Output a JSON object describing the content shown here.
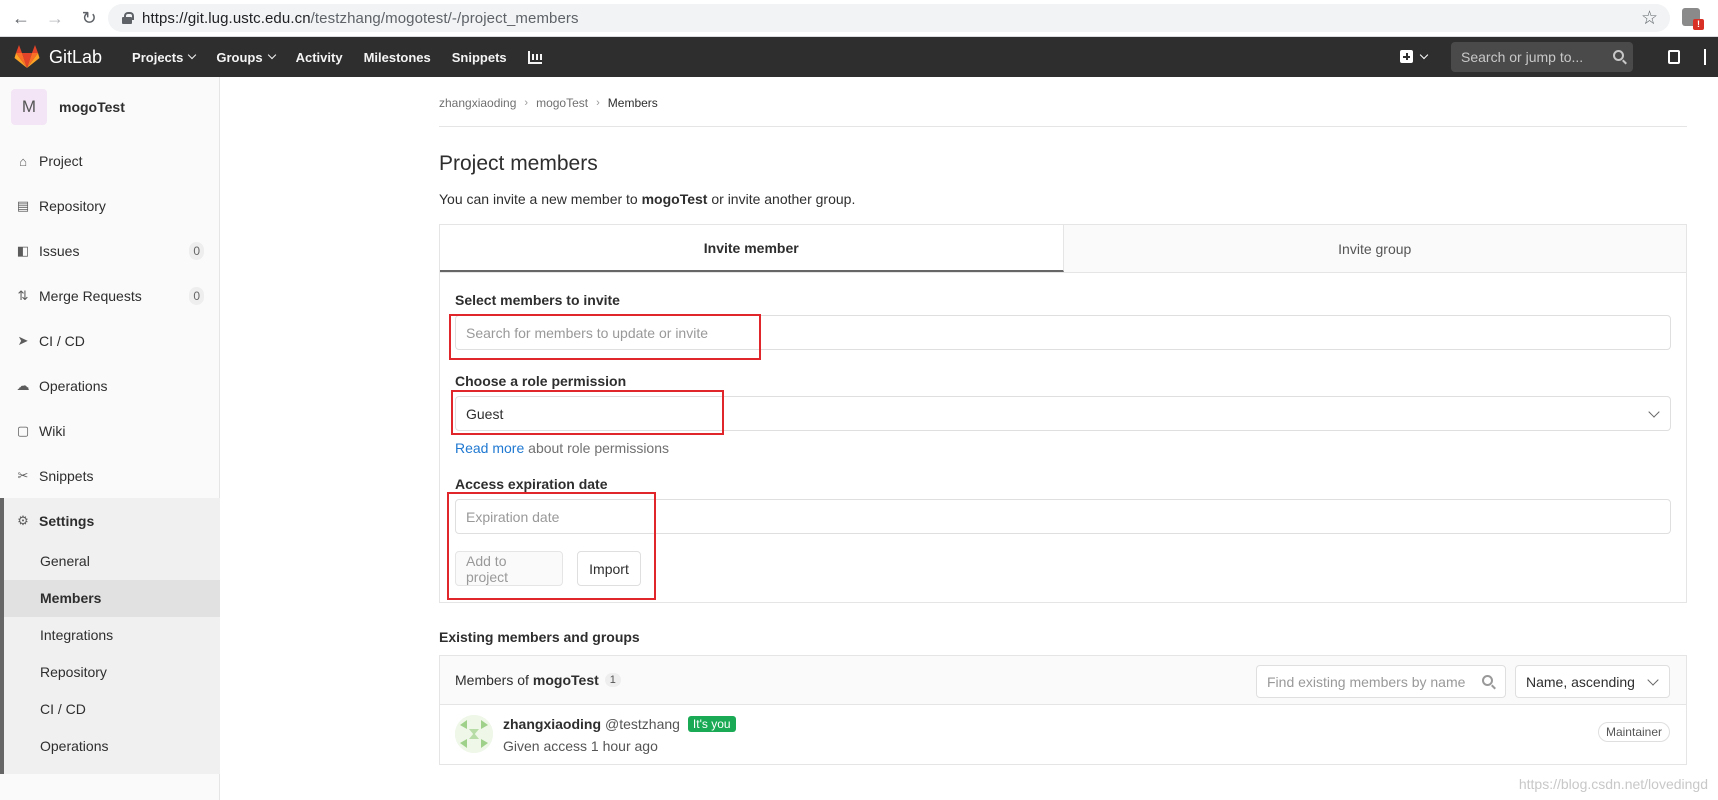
{
  "browser": {
    "url_host": "https://git.lug.ustc.edu.cn",
    "url_path": "/testzhang/mogotest/-/project_members"
  },
  "header": {
    "brand": "GitLab",
    "nav": [
      {
        "label": "Projects",
        "dropdown": true
      },
      {
        "label": "Groups",
        "dropdown": true
      },
      {
        "label": "Activity",
        "dropdown": false
      },
      {
        "label": "Milestones",
        "dropdown": false
      },
      {
        "label": "Snippets",
        "dropdown": false
      }
    ],
    "search_placeholder": "Search or jump to..."
  },
  "sidebar": {
    "avatar_letter": "M",
    "project_name": "mogoTest",
    "items": [
      {
        "label": "Project",
        "icon": "home-icon"
      },
      {
        "label": "Repository",
        "icon": "doc-icon"
      },
      {
        "label": "Issues",
        "icon": "issues-icon",
        "count": "0"
      },
      {
        "label": "Merge Requests",
        "icon": "merge-icon",
        "count": "0"
      },
      {
        "label": "CI / CD",
        "icon": "rocket-icon"
      },
      {
        "label": "Operations",
        "icon": "cloud-gear-icon"
      },
      {
        "label": "Wiki",
        "icon": "book-icon"
      },
      {
        "label": "Snippets",
        "icon": "scissors-icon"
      },
      {
        "label": "Settings",
        "icon": "gear-icon"
      }
    ],
    "settings_sub": [
      "General",
      "Members",
      "Integrations",
      "Repository",
      "CI / CD",
      "Operations"
    ]
  },
  "breadcrumb": [
    "zhangxiaoding",
    "mogoTest",
    "Members"
  ],
  "page": {
    "title": "Project members",
    "desc_prefix": "You can invite a new member to ",
    "desc_project": "mogoTest",
    "desc_suffix": " or invite another group."
  },
  "invite": {
    "tabs": [
      "Invite member",
      "Invite group"
    ],
    "select_label": "Select members to invite",
    "select_placeholder": "Search for members to update or invite",
    "role_label": "Choose a role permission",
    "role_value": "Guest",
    "read_more": "Read more",
    "read_more_suffix": " about role permissions",
    "expiry_label": "Access expiration date",
    "expiry_placeholder": "Expiration date",
    "add_button": "Add to project",
    "import_button": "Import"
  },
  "existing": {
    "title": "Existing members and groups",
    "members_of": "Members of",
    "project": "mogoTest",
    "count": "1",
    "find_placeholder": "Find existing members by name",
    "sort_value": "Name, ascending",
    "members": [
      {
        "name": "zhangxiaoding",
        "username": "@testzhang",
        "badge": "It's you",
        "access": "Given access 1 hour ago",
        "role": "Maintainer"
      }
    ]
  },
  "watermark": "https://blog.csdn.net/lovedingd",
  "colors": {
    "accent_blue": "#1f78d1",
    "badge_green": "#1aaa55",
    "header_bg": "#2e2e2e",
    "highlight_red": "#e0262a"
  }
}
